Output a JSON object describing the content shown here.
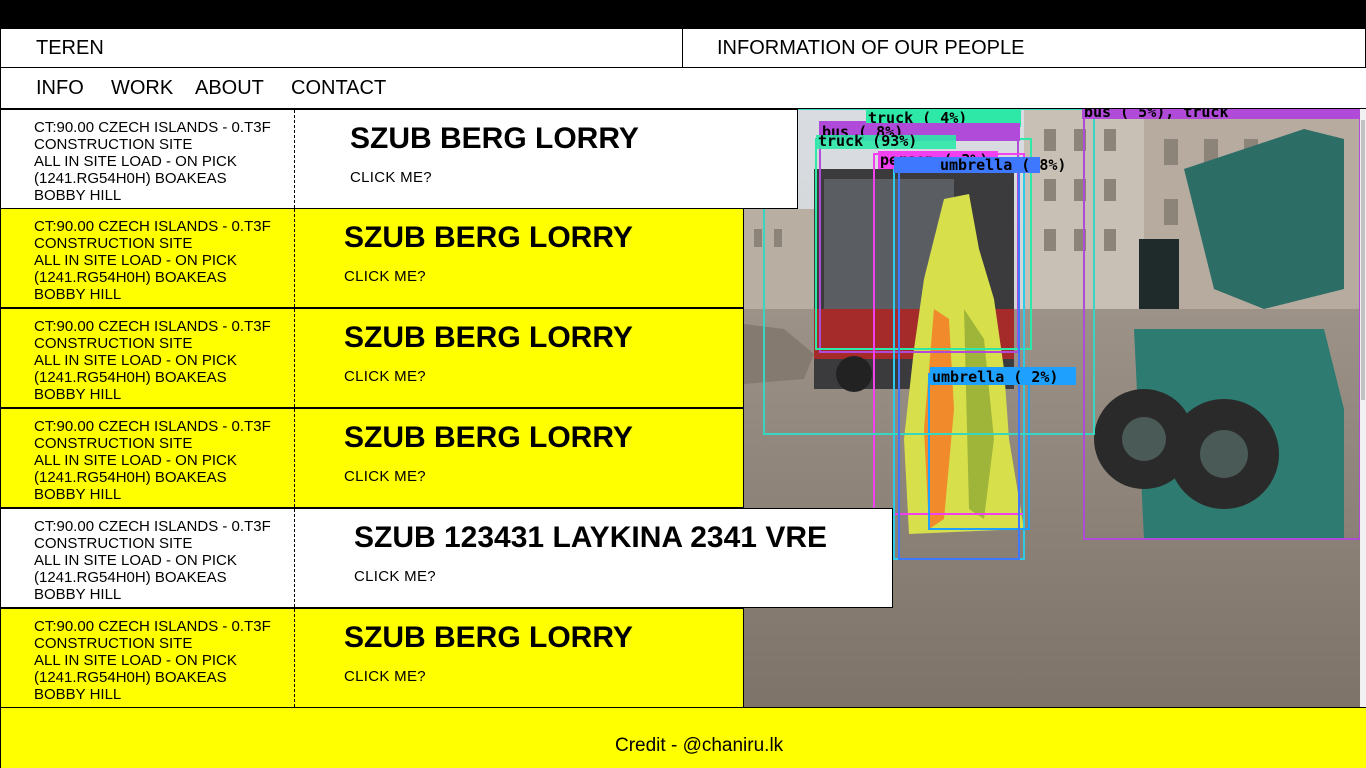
{
  "header": {
    "brand": "TEREN",
    "tagline": "INFORMATION OF OUR PEOPLE"
  },
  "nav": {
    "items": [
      "INFO",
      "WORK",
      "ABOUT",
      "CONTACT"
    ]
  },
  "listings": [
    {
      "meta": [
        "CT:90.00 CZECH ISLANDS - 0.T3F",
        "CONSTRUCTION SITE",
        "ALL IN SITE LOAD - ON PICK",
        "(1241.RG54H0H) BOAKEAS",
        "BOBBY HILL"
      ],
      "title": "SZUB BERG LORRY",
      "cta": "CLICK ME?",
      "bg": "#ffffff"
    },
    {
      "meta": [
        "CT:90.00 CZECH ISLANDS - 0.T3F",
        "CONSTRUCTION SITE",
        "ALL IN SITE LOAD - ON PICK",
        "(1241.RG54H0H) BOAKEAS",
        "BOBBY HILL"
      ],
      "title": "SZUB BERG LORRY",
      "cta": "CLICK ME?",
      "bg": "#ffff00"
    },
    {
      "meta": [
        "CT:90.00 CZECH ISLANDS - 0.T3F",
        "CONSTRUCTION SITE",
        "ALL IN SITE LOAD - ON PICK",
        "(1241.RG54H0H) BOAKEAS",
        "BOBBY HILL"
      ],
      "title": "SZUB BERG LORRY",
      "cta": "CLICK ME?",
      "bg": "#ffff00"
    },
    {
      "meta": [
        "CT:90.00 CZECH ISLANDS - 0.T3F",
        "CONSTRUCTION SITE",
        "ALL IN SITE LOAD - ON PICK",
        "(1241.RG54H0H) BOAKEAS",
        "BOBBY HILL"
      ],
      "title": "SZUB BERG LORRY",
      "cta": "CLICK ME?",
      "bg": "#ffff00"
    },
    {
      "meta": [
        "CT:90.00 CZECH ISLANDS - 0.T3F",
        "CONSTRUCTION SITE",
        "ALL IN SITE LOAD - ON PICK",
        "(1241.RG54H0H) BOAKEAS",
        "BOBBY HILL"
      ],
      "title": "SZUB 123431 LAYKINA 2341 VRE",
      "cta": "CLICK ME?",
      "bg": "#ffffff"
    },
    {
      "meta": [
        "CT:90.00 CZECH ISLANDS - 0.T3F",
        "CONSTRUCTION SITE",
        "ALL IN SITE LOAD - ON PICK",
        "(1241.RG54H0H) BOAKEAS",
        "BOBBY HILL"
      ],
      "title": "SZUB BERG LORRY",
      "cta": "CLICK ME?",
      "bg": "#ffff00"
    }
  ],
  "detections": {
    "labels": [
      "truck ( 4%)",
      "bus ( 8%)",
      "truck (93%)",
      "person ( 3%)",
      "umbrella ( 8%)",
      "umbrella ( 2%)",
      "bus ( 5%), truck"
    ]
  },
  "footer": {
    "credit": "Credit - @chaniru.lk"
  },
  "colors": {
    "accent": "#ffff00",
    "text": "#000000"
  }
}
